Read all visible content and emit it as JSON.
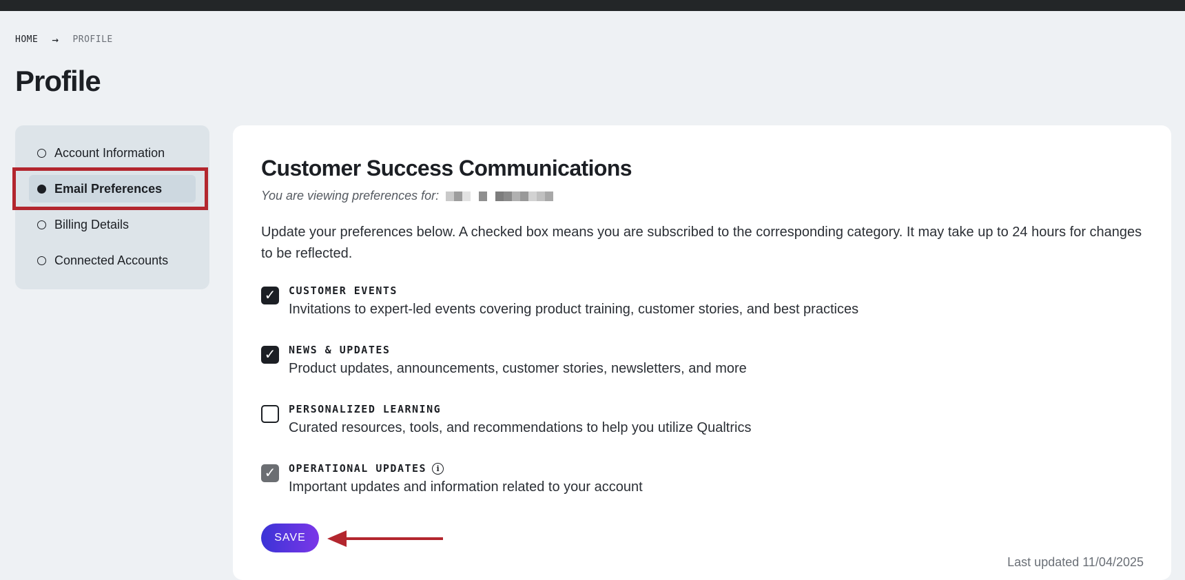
{
  "breadcrumb": {
    "home": "HOME",
    "separator": "→",
    "current": "PROFILE"
  },
  "page": {
    "title": "Profile"
  },
  "sidebar": {
    "items": [
      {
        "label": "Account Information",
        "active": false
      },
      {
        "label": "Email Preferences",
        "active": true
      },
      {
        "label": "Billing Details",
        "active": false
      },
      {
        "label": "Connected Accounts",
        "active": false
      }
    ]
  },
  "card": {
    "title": "Customer Success Communications",
    "viewing_label": "You are viewing preferences for:",
    "intro": "Update your preferences below. A checked box means you are subscribed to the corresponding category. It may take up to 24 hours for changes to be reflected.",
    "preferences": [
      {
        "label": "CUSTOMER EVENTS",
        "description": "Invitations to expert-led events covering product training, customer stories, and best practices",
        "checked": true,
        "disabled": false
      },
      {
        "label": "NEWS & UPDATES",
        "description": "Product updates, announcements, customer stories, newsletters, and more",
        "checked": true,
        "disabled": false
      },
      {
        "label": "PERSONALIZED LEARNING",
        "description": "Curated resources, tools, and recommendations to help you utilize Qualtrics",
        "checked": false,
        "disabled": false
      },
      {
        "label": "OPERATIONAL UPDATES",
        "description": "Important updates and information related to your account",
        "checked": true,
        "disabled": true,
        "info_icon": "info-icon"
      }
    ],
    "save_label": "SAVE",
    "last_updated": "Last updated 11/04/2025"
  },
  "colors": {
    "topbar": "#232628",
    "background": "#eef1f4",
    "sidebar_bg": "#dde4e9",
    "highlight_annotation": "#b3262e",
    "save_gradient_start": "#3b34d6",
    "save_gradient_end": "#7b36e8"
  },
  "icons": {
    "check": "check-icon",
    "info": "info-icon",
    "arrow": "arrow-right-icon"
  }
}
